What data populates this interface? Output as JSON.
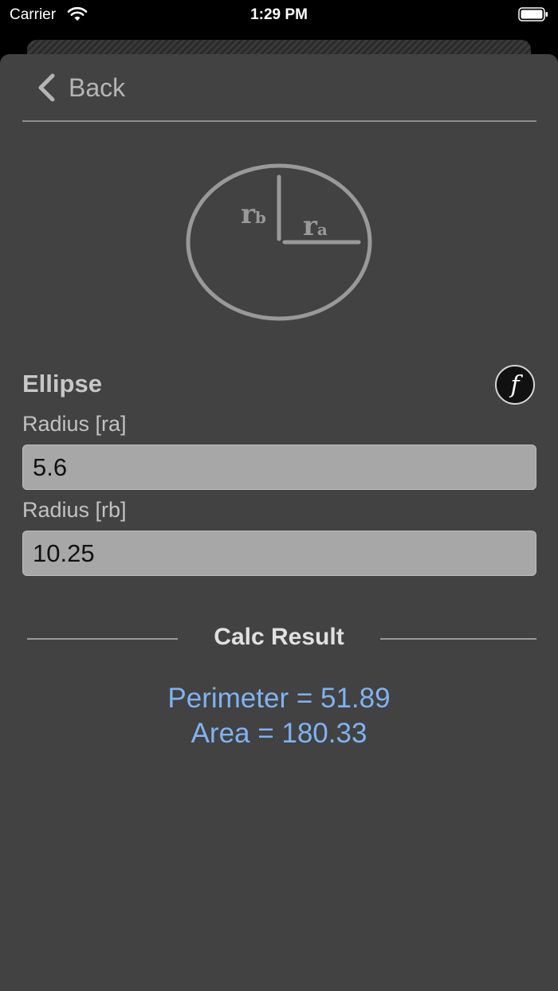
{
  "status_bar": {
    "carrier": "Carrier",
    "time": "1:29 PM",
    "icons": [
      "wifi-icon",
      "battery-icon"
    ]
  },
  "nav": {
    "back_label": "Back",
    "back_icon": "chevron-left-icon"
  },
  "diagram": {
    "label_rb": "r",
    "label_rb_sub": "b",
    "label_ra": "r",
    "label_ra_sub": "a"
  },
  "form": {
    "title": "Ellipse",
    "formula_button_label": "f",
    "radius_a_label": "Radius [ra]",
    "radius_a_value": "5.6",
    "radius_b_label": "Radius [rb]",
    "radius_b_value": "10.25"
  },
  "result": {
    "title": "Calc Result",
    "perimeter": "Perimeter = 51.89",
    "area": "Area = 180.33"
  },
  "colors": {
    "background": "#424242",
    "field_fill": "#a7a7a7",
    "result_text": "#7fb3f2",
    "diagram_stroke": "#999999"
  }
}
